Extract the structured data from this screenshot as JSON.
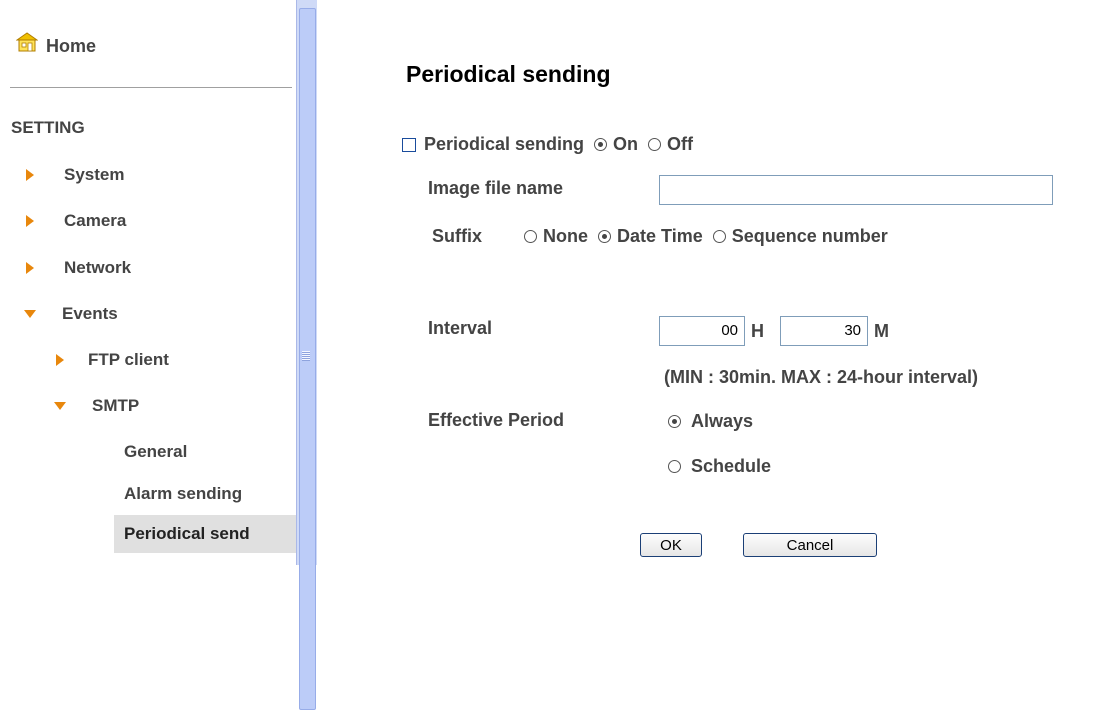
{
  "sidebar": {
    "home_label": "Home",
    "section_title": "SETTING",
    "items": [
      {
        "label": "System"
      },
      {
        "label": "Camera"
      },
      {
        "label": "Network"
      },
      {
        "label": "Events"
      }
    ],
    "events_children": [
      {
        "label": "FTP client"
      },
      {
        "label": "SMTP"
      }
    ],
    "smtp_children": [
      {
        "label": "General"
      },
      {
        "label": "Alarm sending"
      },
      {
        "label": "Periodical send"
      }
    ]
  },
  "page": {
    "title": "Periodical sending",
    "periodical_label": "Periodical sending",
    "on_label": "On",
    "off_label": "Off",
    "periodical_value": "On",
    "image_file_label": "Image file name",
    "image_file_value": "",
    "suffix_label": "Suffix",
    "suffix_options": [
      "None",
      "Date Time",
      "Sequence number"
    ],
    "suffix_value": "Date Time",
    "interval_label": "Interval",
    "interval_hours": "00",
    "hours_unit": "H",
    "interval_minutes": "30",
    "minutes_unit": "M",
    "interval_note": "(MIN : 30min. MAX : 24-hour interval)",
    "effective_label": "Effective Period",
    "always_label": "Always",
    "schedule_label": "Schedule",
    "effective_value": "Always",
    "ok_label": "OK",
    "cancel_label": "Cancel"
  },
  "colors": {
    "accent_arrow": "#e8870c",
    "text": "#444444",
    "scrollbar": "#cfdaf7"
  }
}
